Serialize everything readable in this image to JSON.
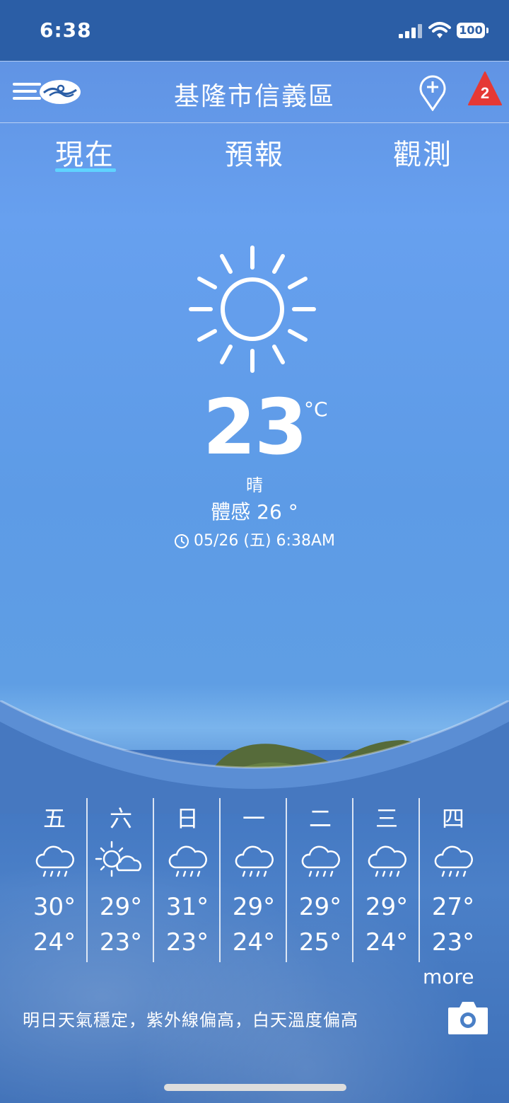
{
  "status_bar": {
    "time": "6:38",
    "battery": "100"
  },
  "header": {
    "location": "基隆市信義區",
    "alert_count": "2"
  },
  "tabs": [
    {
      "label": "現在",
      "active": true
    },
    {
      "label": "預報",
      "active": false
    },
    {
      "label": "觀測",
      "active": false
    }
  ],
  "current": {
    "icon": "sunny-icon",
    "temperature": "23",
    "unit": "°C",
    "condition": "晴",
    "feels_like": "體感 26 °",
    "updated": "05/26 (五) 6:38AM"
  },
  "forecast": [
    {
      "day": "五",
      "icon": "rain-icon",
      "high": "30°",
      "low": "24°"
    },
    {
      "day": "六",
      "icon": "sun-cloud-icon",
      "high": "29°",
      "low": "23°"
    },
    {
      "day": "日",
      "icon": "rain-icon",
      "high": "31°",
      "low": "23°"
    },
    {
      "day": "一",
      "icon": "rain-icon",
      "high": "29°",
      "low": "24°"
    },
    {
      "day": "二",
      "icon": "rain-icon",
      "high": "29°",
      "low": "25°"
    },
    {
      "day": "三",
      "icon": "rain-icon",
      "high": "29°",
      "low": "24°"
    },
    {
      "day": "四",
      "icon": "rain-icon",
      "high": "27°",
      "low": "23°"
    }
  ],
  "more_label": "more",
  "summary": "明日天氣穩定，紫外線偏高，白天溫度偏高",
  "colors": {
    "status_bg": "#2b5ea6",
    "tab_underline": "#5fd3ff",
    "alert_red": "#e53935"
  }
}
